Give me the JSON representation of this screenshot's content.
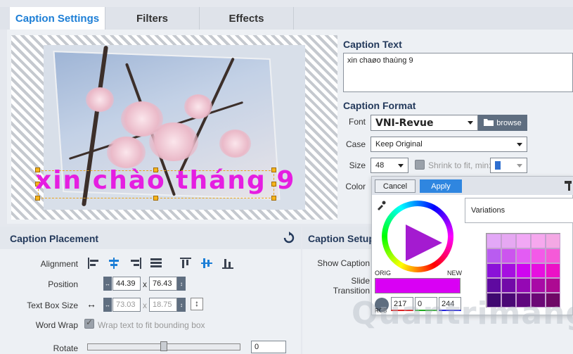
{
  "tabs": [
    {
      "label": "Caption Settings"
    },
    {
      "label": "Filters"
    },
    {
      "label": "Effects"
    }
  ],
  "preview": {
    "caption_text": "xin chào tháng 9"
  },
  "caption_text": {
    "title": "Caption Text",
    "value": "xin chaøo thaùng 9"
  },
  "caption_format": {
    "title": "Caption Format",
    "font_label": "Font",
    "font_value": "VNI-Revue",
    "browse_label": "browse",
    "case_label": "Case",
    "case_value": "Keep Original",
    "size_label": "Size",
    "size_value": "48",
    "shrink_label": "Shrink to fit, min:",
    "color_label": "Color"
  },
  "color_popup": {
    "cancel_label": "Cancel",
    "apply_label": "Apply",
    "orig_label": "ORIG",
    "new_label": "NEW",
    "rgb_label": "RGB",
    "r": "217",
    "g": "0",
    "b": "244",
    "variations_label": "Variations",
    "new_color": "#d900f4"
  },
  "placement": {
    "title": "Caption Placement",
    "alignment_label": "Alignment",
    "position_label": "Position",
    "position_x": "44.39",
    "position_y": "76.43",
    "textbox_label": "Text Box Size",
    "textbox_w": "73.03",
    "textbox_h": "18.75",
    "x_sep": "x",
    "wordwrap_label": "Word Wrap",
    "wordwrap_text": "Wrap text to fit bounding box",
    "rotate_label": "Rotate",
    "rotate_value": "0"
  },
  "setup": {
    "title": "Caption Setup",
    "show_caption_label": "Show Caption",
    "slide_transition_label": "Slide Transition"
  },
  "watermark": "Quantrimang",
  "colors": {
    "accent": "#1c7ed6",
    "caption": "#e51ee1",
    "apply": "#2f86e0"
  }
}
